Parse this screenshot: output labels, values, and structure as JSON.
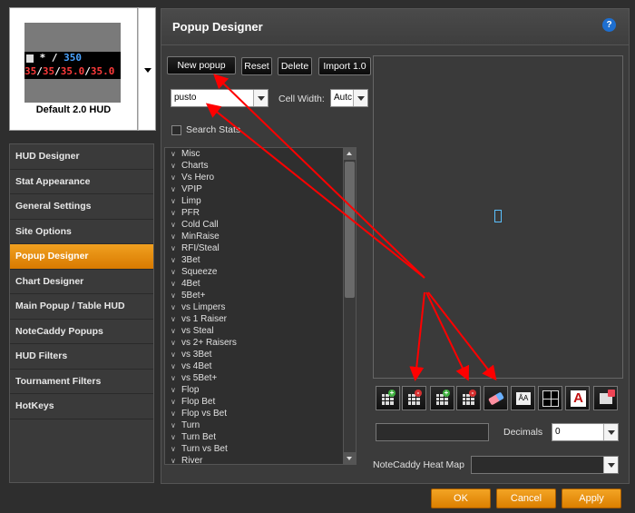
{
  "hud_preview": {
    "line1_prefix": "* /",
    "line1_value": "350",
    "line2_values": [
      "35",
      "35",
      "35.0",
      "35.0"
    ],
    "label": "Default 2.0 HUD"
  },
  "nav": {
    "items": [
      {
        "label": "HUD Designer"
      },
      {
        "label": "Stat Appearance"
      },
      {
        "label": "General Settings"
      },
      {
        "label": "Site Options"
      },
      {
        "label": "Popup Designer"
      },
      {
        "label": "Chart Designer"
      },
      {
        "label": "Main Popup / Table HUD"
      },
      {
        "label": "NoteCaddy Popups"
      },
      {
        "label": "HUD Filters"
      },
      {
        "label": "Tournament Filters"
      },
      {
        "label": "HotKeys"
      }
    ],
    "active_index": 4
  },
  "panel": {
    "title": "Popup Designer",
    "help_glyph": "?"
  },
  "toolbar": {
    "new_popup": "New popup",
    "reset": "Reset",
    "delete": "Delete",
    "import": "Import 1.0"
  },
  "popup_select": {
    "value": "pusto"
  },
  "cell_width": {
    "label": "Cell Width:",
    "value": "Autc"
  },
  "search_stats": {
    "label": "Search Stats",
    "checked": false
  },
  "stat_list": {
    "items": [
      "Misc",
      "Charts",
      "Vs Hero",
      "VPIP",
      "Limp",
      "PFR",
      "Cold Call",
      "MinRaise",
      "RFI/Steal",
      "3Bet",
      "Squeeze",
      "4Bet",
      "5Bet+",
      "vs Limpers",
      "vs 1 Raiser",
      "vs Steal",
      "vs 2+ Raisers",
      "vs 3Bet",
      "vs 4Bet",
      "vs 5Bet+",
      "Flop",
      "Flop Bet",
      "Flop vs Bet",
      "Turn",
      "Turn Bet",
      "Turn vs Bet",
      "River"
    ]
  },
  "tools": [
    {
      "icon": "add-column-icon"
    },
    {
      "icon": "remove-column-icon"
    },
    {
      "icon": "add-row-icon"
    },
    {
      "icon": "remove-row-icon"
    },
    {
      "icon": "eraser-icon"
    },
    {
      "icon": "font-size-icon",
      "text": "ÂA"
    },
    {
      "icon": "crosshair-icon"
    },
    {
      "icon": "font-color-icon",
      "text": "A"
    },
    {
      "icon": "export-icon"
    }
  ],
  "decimals": {
    "label": "Decimals",
    "value": "0"
  },
  "heat_map": {
    "label": "NoteCaddy Heat Map",
    "value": ""
  },
  "footer": {
    "ok": "OK",
    "cancel": "Cancel",
    "apply": "Apply"
  },
  "colors": {
    "accent": "#e88a10",
    "annotation_arrow": "#ff0000",
    "panel_bg": "#3b3b3b"
  }
}
